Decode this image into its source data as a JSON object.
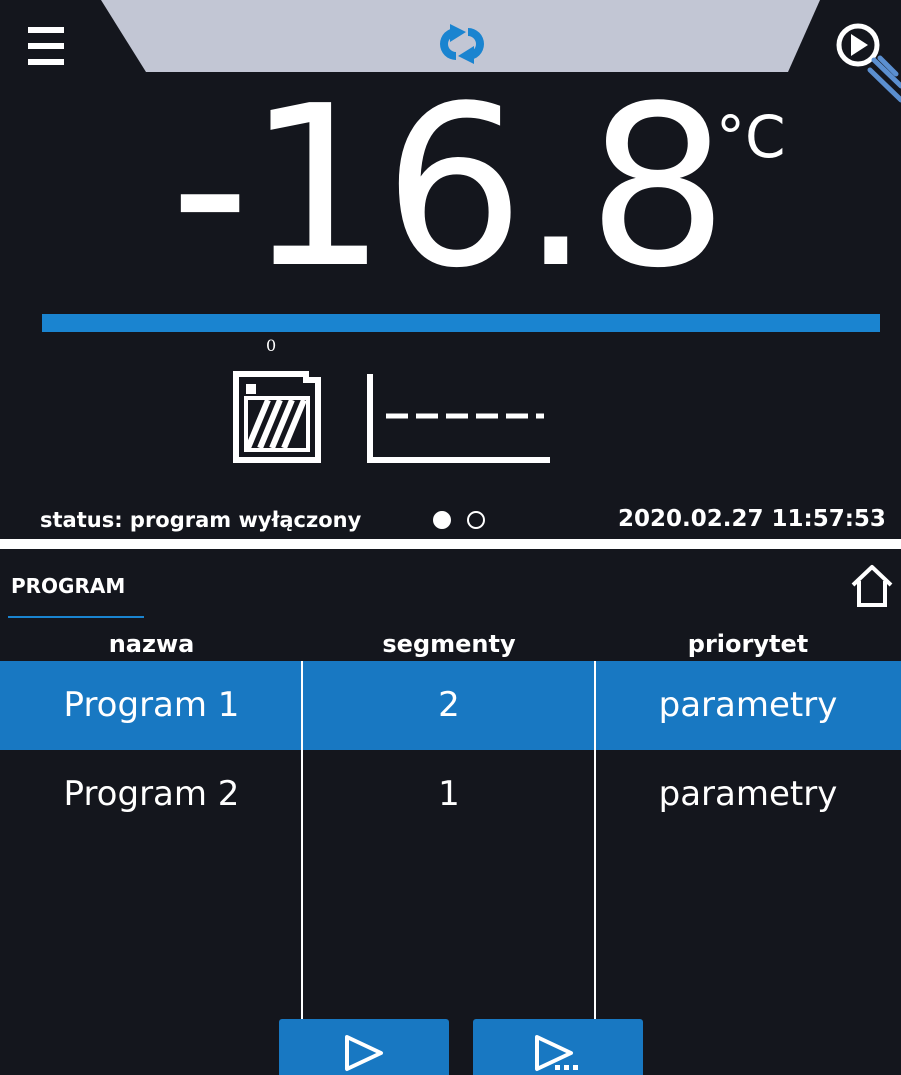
{
  "top_screen": {
    "temperature": "-16.8",
    "unit": "°C",
    "temperature_progress_percent": 100,
    "chamber_count": "0",
    "status": "status: program wyłączony",
    "datetime": "2020.02.27  11:57:53",
    "page_count": 2,
    "active_page": 1,
    "icons": [
      "menu-icon",
      "sync-icon",
      "play-circle-icon",
      "chamber-icon",
      "chart-icon"
    ]
  },
  "bottom_screen": {
    "title": "PROGRAM",
    "columns": [
      "nazwa",
      "segmenty",
      "priorytet"
    ],
    "rows": [
      {
        "name": "Program 1",
        "segments": "2",
        "priority": "parametry",
        "selected": true
      },
      {
        "name": "Program 2",
        "segments": "1",
        "priority": "parametry",
        "selected": false
      }
    ],
    "buttons": [
      "play-icon",
      "play-more-icon"
    ],
    "icons": [
      "home-icon"
    ]
  },
  "colors": {
    "background": "#14161d",
    "accent_blue": "#1878c2",
    "progress_blue": "#1a84d0",
    "tab_gray": "#c2c6d4",
    "text": "#ffffff"
  }
}
